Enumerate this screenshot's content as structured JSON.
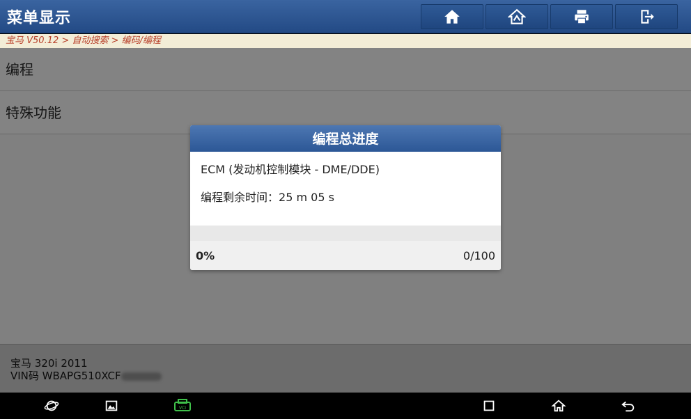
{
  "header": {
    "title": "菜单显示",
    "buttons": [
      "home-icon",
      "vehicle-home-icon",
      "printer-icon",
      "exit-icon"
    ]
  },
  "breadcrumb": "宝马 V50.12 > 自动搜索 > 编码/编程",
  "menu": [
    {
      "label": "编程"
    },
    {
      "label": "特殊功能"
    }
  ],
  "dialog": {
    "title": "编程总进度",
    "module": "ECM (发动机控制模块 - DME/DDE)",
    "remaining_label": "编程剩余时间：",
    "remaining_value": "25 m 05 s",
    "progress_percent_text": "0%",
    "progress_count": "0/100",
    "progress_fraction": 0
  },
  "footer": {
    "vehicle": "宝马 320i 2011",
    "vin": "VIN码 WBAPG510XCF"
  },
  "navbar": {
    "icons": [
      "browser-icon",
      "gallery-icon",
      "vci-icon",
      "recent-apps-icon",
      "home-icon",
      "back-icon"
    ],
    "vci_color": "#3fc04a"
  }
}
